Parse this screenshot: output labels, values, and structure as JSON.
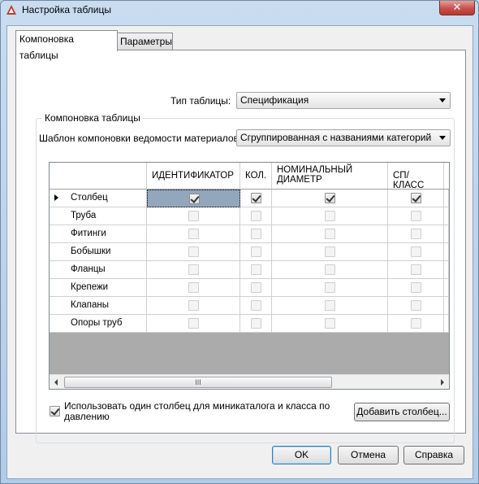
{
  "window": {
    "title": "Настройка таблицы",
    "close_glyph": "✕"
  },
  "tabs": [
    {
      "label": "Компоновка таблицы",
      "active": true
    },
    {
      "label": "Параметры",
      "active": false
    }
  ],
  "table_type": {
    "label": "Тип таблицы:",
    "value": "Спецификация"
  },
  "layout_group": {
    "caption": "Компоновка таблицы",
    "template_label": "Шаблон компоновки ведомости материалов:",
    "template_value": "Сгруппированная с названиями категорий"
  },
  "grid": {
    "columns": [
      {
        "label": "ИДЕНТИФИКАТОР"
      },
      {
        "label": "КОЛ."
      },
      {
        "label": "НОМИНАЛЬНЫЙ ДИАМЕТР"
      },
      {
        "label": "СП/КЛАСС"
      }
    ],
    "rows": [
      {
        "label": "Столбец",
        "current": true,
        "checks": [
          true,
          true,
          true,
          true
        ]
      },
      {
        "label": "Труба",
        "current": false,
        "checks": [
          false,
          false,
          false,
          false
        ]
      },
      {
        "label": "Фитинги",
        "current": false,
        "checks": [
          false,
          false,
          false,
          false
        ]
      },
      {
        "label": "Бобышки",
        "current": false,
        "checks": [
          false,
          false,
          false,
          false
        ]
      },
      {
        "label": "Фланцы",
        "current": false,
        "checks": [
          false,
          false,
          false,
          false
        ]
      },
      {
        "label": "Крепежи",
        "current": false,
        "checks": [
          false,
          false,
          false,
          false
        ]
      },
      {
        "label": "Клапаны",
        "current": false,
        "checks": [
          false,
          false,
          false,
          false
        ]
      },
      {
        "label": "Опоры труб",
        "current": false,
        "checks": [
          false,
          false,
          false,
          false
        ]
      }
    ],
    "scroll_grip": "III"
  },
  "single_column_option": {
    "checked": true,
    "label": "Использовать один столбец для миникаталога и класса по давлению"
  },
  "add_column_button": "Добавить столбец...",
  "footer": {
    "ok": "OK",
    "cancel": "Отмена",
    "help": "Справка"
  }
}
